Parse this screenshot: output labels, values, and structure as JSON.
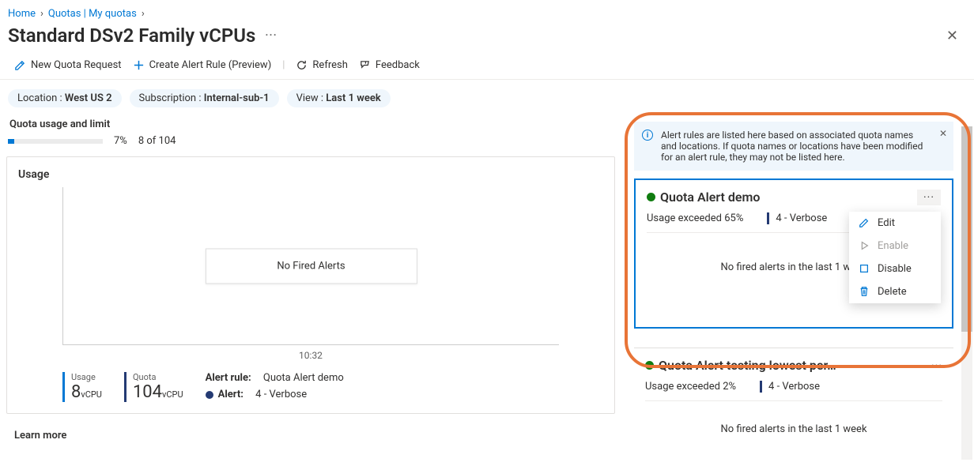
{
  "breadcrumb": {
    "home": "Home",
    "quotas": "Quotas | My quotas"
  },
  "title": "Standard DSv2 Family vCPUs",
  "toolbar": {
    "new_request": "New Quota Request",
    "create_rule": "Create Alert Rule (Preview)",
    "refresh": "Refresh",
    "feedback": "Feedback"
  },
  "filters": {
    "loc_label": "Location : ",
    "loc_value": "West US 2",
    "sub_label": "Subscription : ",
    "sub_value": "Internal-sub-1",
    "view_label": "View : ",
    "view_value": "Last 1 week"
  },
  "quota": {
    "section_title": "Quota usage and limit",
    "pct": "7%",
    "count": "8 of 104",
    "card_title": "Usage",
    "no_fired": "No Fired Alerts",
    "x_axis": "10:32"
  },
  "legend": {
    "usage_label": "Usage",
    "usage_value": "8",
    "usage_unit": "vCPU",
    "quota_label": "Quota",
    "quota_value": "104",
    "quota_unit": "vCPU",
    "rule_label": "Alert rule:",
    "rule_value": "Quota Alert demo",
    "alert_label": "Alert:",
    "alert_value": "4 - Verbose"
  },
  "learn_more": "Learn more",
  "banner": "Alert rules are listed here based on associated quota names and locations. If quota names or locations have been modified for an alert rule, they may not be listed here.",
  "alert1": {
    "title": "Quota Alert demo",
    "meta1": "Usage exceeded 65%",
    "meta2": "4 - Verbose",
    "empty": "No fired alerts in the last 1 week"
  },
  "alert2": {
    "title": "Quota Alert testing lowest per…",
    "meta1": "Usage exceeded 2%",
    "meta2": "4 - Verbose",
    "empty": "No fired alerts in the last 1 week"
  },
  "menu": {
    "edit": "Edit",
    "enable": "Enable",
    "disable": "Disable",
    "delete": "Delete"
  }
}
